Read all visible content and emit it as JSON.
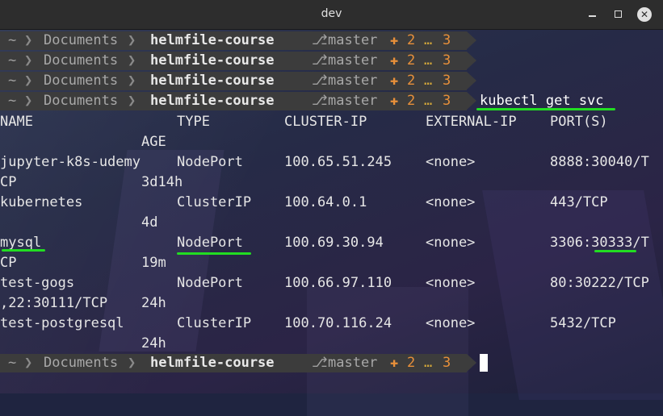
{
  "window": {
    "title": "dev",
    "controls": [
      "minimize",
      "maximize",
      "close"
    ]
  },
  "prompt": {
    "tilde": "~",
    "chevron": "❯",
    "documents": "Documents",
    "repo": "helmfile-course",
    "branch_icon": "⎇",
    "branch": "master",
    "plus": "✚",
    "staged": "2",
    "dots": "…",
    "untracked": "3"
  },
  "command": "kubectl get svc",
  "headers": {
    "name": "NAME",
    "type": "TYPE",
    "cluster_ip": "CLUSTER-IP",
    "external_ip": "EXTERNAL-IP",
    "ports": "PORT(S)",
    "age": "AGE"
  },
  "rows": [
    {
      "name": "jupyter-k8s-udemy",
      "type": "NodePort",
      "cluster_ip": "100.65.51.245",
      "external_ip": "<none>",
      "ports": "8888:30040/T",
      "wrap": "CP",
      "age": "3d14h"
    },
    {
      "name": "kubernetes",
      "type": "ClusterIP",
      "cluster_ip": "100.64.0.1",
      "external_ip": "<none>",
      "ports": "443/TCP",
      "wrap": "",
      "age": "4d"
    },
    {
      "name": "mysql",
      "type": "NodePort",
      "cluster_ip": "100.69.30.94",
      "external_ip": "<none>",
      "ports": "3306:30333/T",
      "wrap": "CP",
      "age": "19m"
    },
    {
      "name": "test-gogs",
      "type": "NodePort",
      "cluster_ip": "100.66.97.110",
      "external_ip": "<none>",
      "ports": "80:30222/TCP",
      "wrap": ",22:30111/TCP",
      "age": "24h"
    },
    {
      "name": "test-postgresql",
      "type": "ClusterIP",
      "cluster_ip": "100.70.116.24",
      "external_ip": "<none>",
      "ports": "5432/TCP",
      "wrap": "",
      "age": "24h"
    }
  ],
  "colors": {
    "highlight": "#22dd22",
    "git_status": "#e8903a",
    "prompt_bg": "#3c3c3c"
  }
}
